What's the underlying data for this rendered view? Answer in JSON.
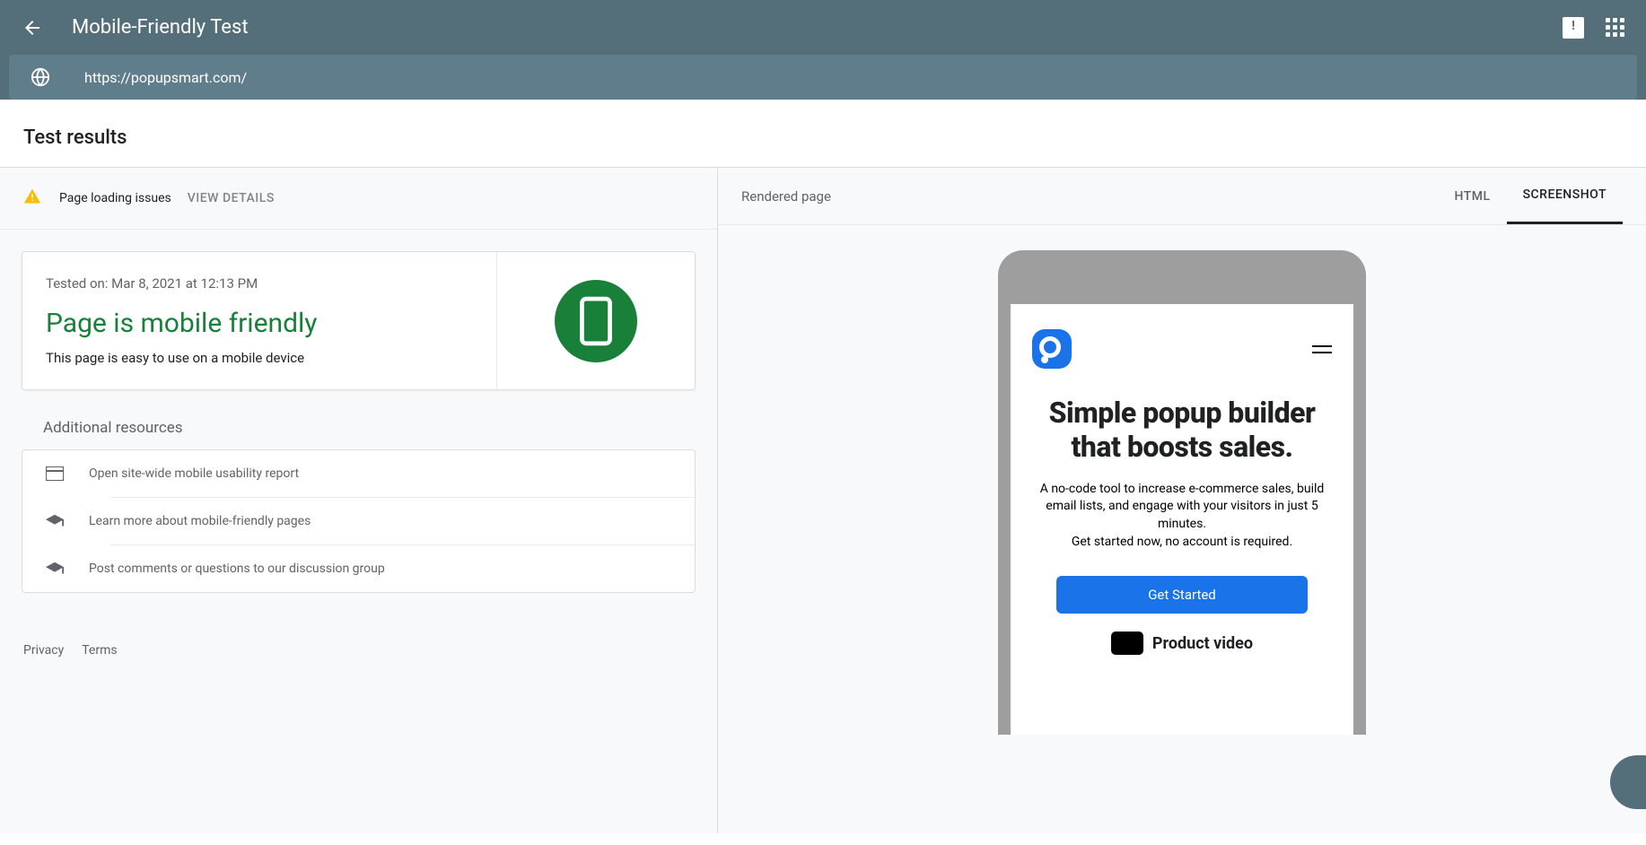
{
  "header": {
    "title": "Mobile-Friendly Test",
    "url": "https://popupsmart.com/"
  },
  "results": {
    "title": "Test results",
    "warning": {
      "text": "Page loading issues",
      "action": "VIEW DETAILS"
    },
    "card": {
      "tested_on": "Tested on: Mar 8, 2021 at 12:13 PM",
      "status": "Page is mobile friendly",
      "description": "This page is easy to use on a mobile device"
    },
    "resources": {
      "title": "Additional resources",
      "items": [
        "Open site-wide mobile usability report",
        "Learn more about mobile-friendly pages",
        "Post comments or questions to our discussion group"
      ]
    }
  },
  "footer": {
    "privacy": "Privacy",
    "terms": "Terms"
  },
  "rightPanel": {
    "label": "Rendered page",
    "tabs": {
      "html": "HTML",
      "screenshot": "SCREENSHOT"
    }
  },
  "preview": {
    "headline": "Simple popup builder that boosts sales.",
    "sub1": "A no-code tool to increase e-commerce sales, build email lists, and engage with your visitors in just 5 minutes.",
    "sub2": "Get started now, no account is required.",
    "cta": "Get Started",
    "product": "Product video"
  }
}
